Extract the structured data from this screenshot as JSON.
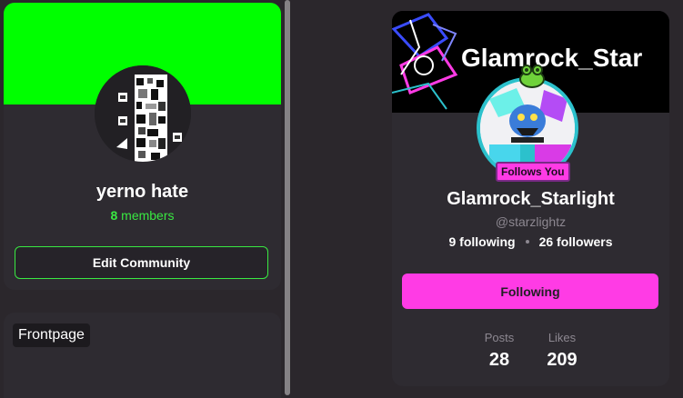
{
  "community": {
    "name": "yerno hate",
    "member_count": "8",
    "member_label": "members",
    "edit_button": "Edit Community",
    "banner_color": "#00ff00",
    "accent_color": "#39e842",
    "frontpage_label": "Frontpage"
  },
  "profile": {
    "banner_text": "Glamrock_Star",
    "follows_you_badge": "Follows You",
    "display_name": "Glamrock_Starlight",
    "handle": "@starzlightz",
    "following_count": "9 following",
    "followers_count": "26 followers",
    "following_button": "Following",
    "posts_label": "Posts",
    "posts_value": "28",
    "likes_label": "Likes",
    "likes_value": "209",
    "accent_color": "#ff3be5"
  }
}
